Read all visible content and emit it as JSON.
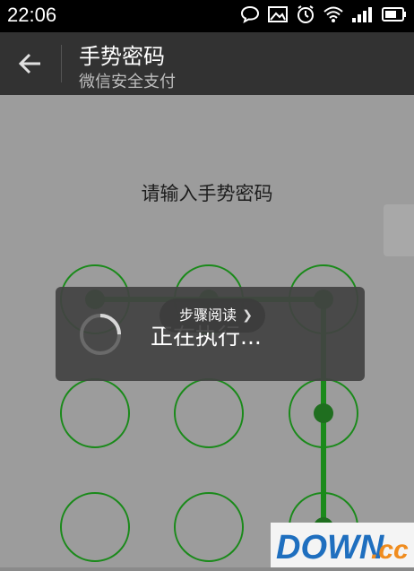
{
  "status_bar": {
    "time": "22:06",
    "icons": [
      "chat-bubble-icon",
      "image-icon",
      "alarm-icon",
      "wifi-icon",
      "signal-icon",
      "battery-icon"
    ]
  },
  "header": {
    "back_icon": "arrow-left-icon",
    "title": "手势密码",
    "subtitle": "微信安全支付"
  },
  "prompt": "请输入手势密码",
  "loading": {
    "text": "正在执行..."
  },
  "tooltip": {
    "label": "步骤阅读"
  },
  "watermark": {
    "text": "DOWN",
    "suffix": ".cc"
  },
  "colors": {
    "statusbar": "#000000",
    "titlebar": "#323232",
    "background": "#9c9c9c",
    "pattern_green": "#1a8a1a",
    "watermark_blue": "#1f6fbf",
    "watermark_orange": "#f08c1e"
  }
}
